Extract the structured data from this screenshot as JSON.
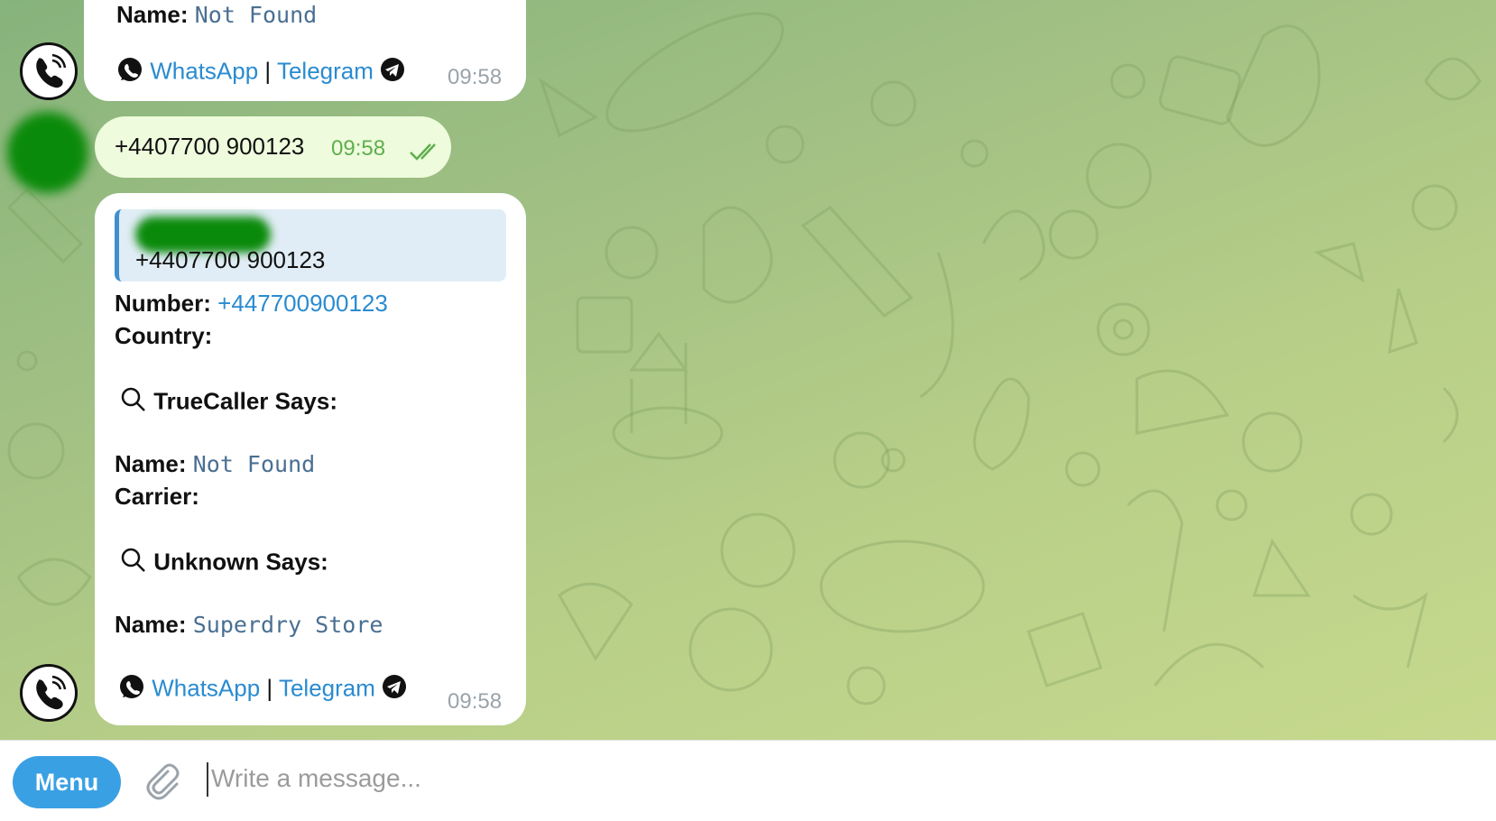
{
  "theme": {
    "accent": "#3aa0e4",
    "link": "#2a8bd0",
    "outgoing_bubble": "#eefbdc",
    "chat_bg": "#a3c184"
  },
  "messages": {
    "top": {
      "name_label": "Name:",
      "name_value": "Not Found",
      "whatsapp": "WhatsApp",
      "separator": "|",
      "telegram": "Telegram",
      "time": "09:58"
    },
    "outgoing": {
      "text": "+4407700 900123",
      "time": "09:58",
      "status_icon": "double-check-icon"
    },
    "result": {
      "quote_text": "+4407700 900123",
      "number_label": "Number:",
      "number_value": "+447700900123",
      "country_label": "Country:",
      "truecaller_heading": "TrueCaller Says:",
      "name_label_1": "Name:",
      "name_value_1": "Not Found",
      "carrier_label": "Carrier:",
      "unknown_heading": "Unknown Says:",
      "name_label_2": "Name:",
      "name_value_2": "Superdry Store",
      "whatsapp": "WhatsApp",
      "separator": "|",
      "telegram": "Telegram",
      "time": "09:58"
    }
  },
  "composer": {
    "menu_label": "Menu",
    "placeholder": "Write a message..."
  }
}
